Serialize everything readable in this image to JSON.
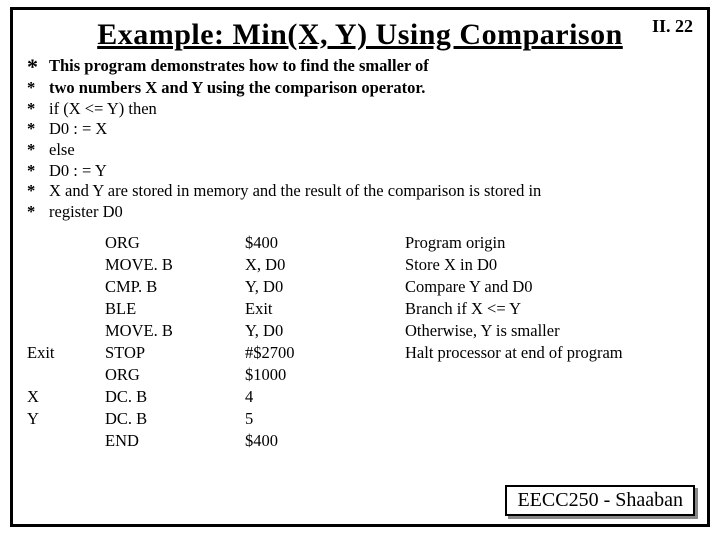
{
  "page_number": "II. 22",
  "title": "Example:  Min(X, Y) Using Comparison",
  "comments": {
    "lead": "This program demonstrates how to find the smaller of",
    "lines": [
      "two numbers X and Y using the comparison operator.",
      "   if (X <= Y) then",
      "     D0 : = X",
      "   else",
      "     D0 : = Y",
      "   X and Y are stored in memory and the result of   the comparison is stored in",
      "   register D0"
    ]
  },
  "asm": [
    {
      "label": "",
      "op": "ORG",
      "arg": "$400",
      "desc": "Program origin"
    },
    {
      "label": "",
      "op": "MOVE. B",
      "arg": "X, D0",
      "desc": "Store X in D0"
    },
    {
      "label": "",
      "op": "CMP. B",
      "arg": "Y, D0",
      "desc": "Compare Y and D0"
    },
    {
      "label": "",
      "op": "BLE",
      "arg": "Exit",
      "desc": "Branch if X <= Y"
    },
    {
      "label": "",
      "op": "MOVE. B",
      "arg": "Y, D0",
      "desc": "Otherwise, Y is smaller"
    },
    {
      "label": "Exit",
      "op": "STOP",
      "arg": " #$2700",
      "desc": "Halt processor at end of program"
    },
    {
      "label": "",
      "op": "ORG",
      "arg": " $1000",
      "desc": ""
    },
    {
      "label": "X",
      "op": "DC. B",
      "arg": "4",
      "desc": ""
    },
    {
      "label": "Y",
      "op": "DC. B",
      "arg": "5",
      "desc": ""
    },
    {
      "label": "",
      "op": "END",
      "arg": "$400",
      "desc": ""
    }
  ],
  "footer": "EECC250 - Shaaban"
}
